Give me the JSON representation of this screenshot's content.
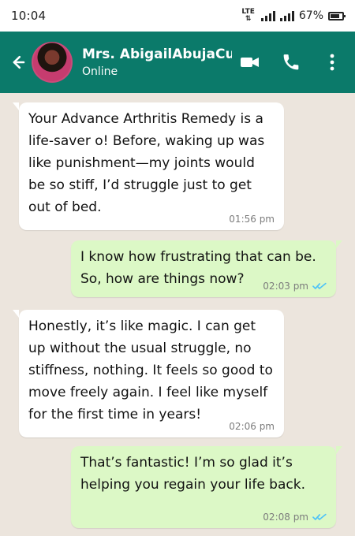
{
  "statusbar": {
    "time": "10:04",
    "network": "LTE",
    "battery": "67%"
  },
  "header": {
    "name": "Mrs. AbigailAbujaCu",
    "status": "Online",
    "icons": {
      "back": "back-arrow-icon",
      "video": "video-call-icon",
      "phone": "phone-icon",
      "menu": "more-vertical-icon"
    }
  },
  "messages": [
    {
      "text": "Your Advance Arthritis Remedy is a life-saver o! Before, waking up was like punishment—my joints would be so stiff, I’d struggle just to get out of bed.",
      "time": "01:56 pm"
    },
    {
      "text": "I know how frustrating that can be. So, how are things now?",
      "time": "02:03 pm"
    },
    {
      "text": "Honestly, it’s like magic. I can get up without the usual struggle, no stiffness, nothing. It feels so good to move freely again. I feel like myself for the first time in years!",
      "time": "02:06 pm"
    },
    {
      "text": "That’s fantastic! I’m so glad it’s helping you regain your life back.",
      "time": "02:08 pm"
    }
  ],
  "colors": {
    "header": "#0b7a6a",
    "chat_bg": "#ece5dd",
    "incoming": "#ffffff",
    "outgoing": "#dcf8c6",
    "read_ticks": "#4fc3f7"
  }
}
